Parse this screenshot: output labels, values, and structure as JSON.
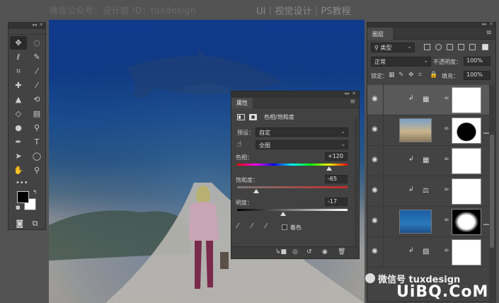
{
  "banner": {
    "left_text": "微信公众号：设计庭  ID：tuxdesign",
    "center_text": "UI｜视觉设计｜PS教程"
  },
  "tools": {
    "icons": [
      "move-tool-icon",
      "marquee-tool-icon",
      "lasso-tool-icon",
      "quick-select-tool-icon",
      "crop-tool-icon",
      "eyedropper-tool-icon",
      "healing-brush-icon",
      "brush-tool-icon",
      "clone-stamp-icon",
      "history-brush-icon",
      "eraser-tool-icon",
      "gradient-tool-icon",
      "blur-tool-icon",
      "dodge-tool-icon",
      "pen-tool-icon",
      "type-tool-icon",
      "path-select-icon",
      "ellipse-tool-icon",
      "hand-tool-icon",
      "zoom-tool-icon"
    ],
    "more_label": "•••",
    "colors": {
      "foreground": "#000000",
      "background": "#ffffff"
    }
  },
  "properties": {
    "tab_label": "属性",
    "adjustment_title": "色相/饱和度",
    "preset_label": "预设：",
    "preset_value": "自定",
    "channel_value": "全图",
    "hue_label": "色相：",
    "hue_value": "+120",
    "saturation_label": "饱和度：",
    "saturation_value": "-65",
    "lightness_label": "明度：",
    "lightness_value": "-17",
    "colorize_label": "着色",
    "sliders": {
      "hue": 120,
      "saturation": -65,
      "lightness": -17
    }
  },
  "layers": {
    "tab_label": "图层",
    "kind_value": "类型",
    "blend_mode": "正常",
    "opacity_label": "不透明度：",
    "opacity_value": "100%",
    "lock_label": "锁定：",
    "fill_label": "填充：",
    "fill_value": "100%"
  },
  "watermark": {
    "wechat_text": "微信号 tuxdesign",
    "site_text": "UiBQ.CoM"
  }
}
